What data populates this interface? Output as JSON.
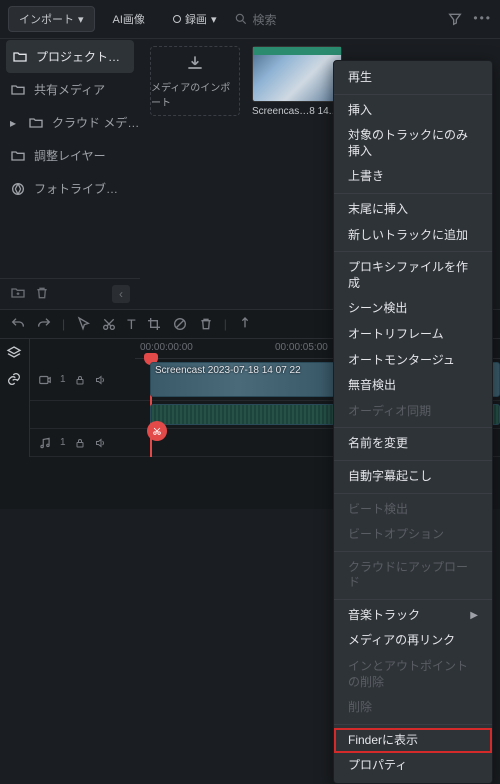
{
  "topbar": {
    "import_label": "インポート",
    "ai_image_label": "AI画像",
    "record_label": "録画",
    "search_placeholder": "検索"
  },
  "sidebar": {
    "items": [
      {
        "label": "プロジェクト…",
        "active": true
      },
      {
        "label": "共有メディア"
      },
      {
        "label": "クラウド メデ…"
      },
      {
        "label": "調整レイヤー"
      },
      {
        "label": "フォトライブ…"
      }
    ]
  },
  "content": {
    "import_tile_label": "メディアのインポート",
    "media_item_label": "Screencas…8 14.…"
  },
  "timeline": {
    "ruler": [
      "00:00:00:00",
      "00:00:05:00"
    ],
    "video_track_label": "1",
    "audio_track_label": "1",
    "clip_label": "Screencast 2023-07-18 14 07 22"
  },
  "context_menu": {
    "items": [
      {
        "label": "再生"
      },
      {
        "sep": true
      },
      {
        "label": "挿入"
      },
      {
        "label": "対象のトラックにのみ挿入"
      },
      {
        "label": "上書き"
      },
      {
        "sep": true
      },
      {
        "label": "末尾に挿入"
      },
      {
        "label": "新しいトラックに追加"
      },
      {
        "sep": true
      },
      {
        "label": "プロキシファイルを作成"
      },
      {
        "label": "シーン検出"
      },
      {
        "label": "オートリフレーム"
      },
      {
        "label": "オートモンタージュ"
      },
      {
        "label": "無音検出"
      },
      {
        "label": "オーディオ同期",
        "disabled": true
      },
      {
        "sep": true
      },
      {
        "label": "名前を変更"
      },
      {
        "sep": true
      },
      {
        "label": "自動字幕起こし"
      },
      {
        "sep": true
      },
      {
        "label": "ビート検出",
        "disabled": true
      },
      {
        "label": "ビートオプション",
        "disabled": true
      },
      {
        "sep": true
      },
      {
        "label": "クラウドにアップロード",
        "disabled": true
      },
      {
        "sep": true
      },
      {
        "label": "音楽トラック",
        "submenu": true
      },
      {
        "label": "メディアの再リンク"
      },
      {
        "label": "インとアウトポイントの削除",
        "disabled": true
      },
      {
        "label": "削除",
        "disabled": true
      },
      {
        "sep": true
      },
      {
        "label": "Finderに表示",
        "highlight": true
      },
      {
        "label": "プロパティ"
      }
    ]
  }
}
